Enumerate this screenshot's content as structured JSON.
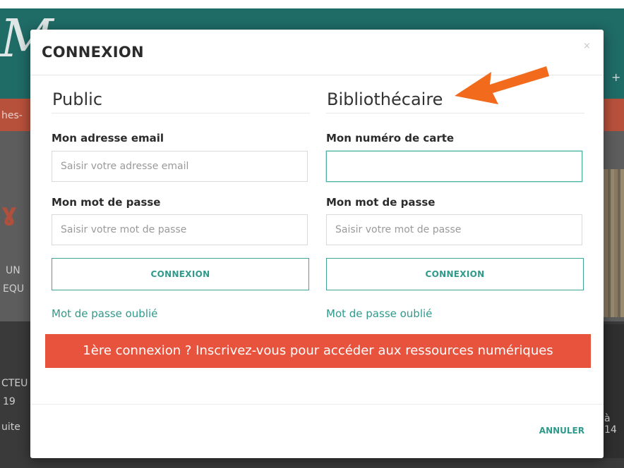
{
  "background": {
    "nav_fragment": "hes-",
    "plus_glyph": "+",
    "fragments": [
      "UN",
      "EQU",
      "CTEU",
      "19",
      "uite",
      "à 14"
    ]
  },
  "modal": {
    "title": "CONNEXION",
    "close_glyph": "×",
    "public": {
      "heading": "Public",
      "email_label": "Mon adresse email",
      "email_placeholder": "Saisir votre adresse email",
      "password_label": "Mon mot de passe",
      "password_placeholder": "Saisir votre mot de passe",
      "login_label": "CONNEXION",
      "forgot_label": "Mot de passe oublié"
    },
    "librarian": {
      "heading": "Bibliothécaire",
      "card_label": "Mon numéro de carte",
      "card_value": "",
      "password_label": "Mon mot de passe",
      "password_placeholder": "Saisir votre mot de passe",
      "login_label": "CONNEXION",
      "forgot_label": "Mot de passe oublié"
    },
    "signup_banner": "1ère connexion ? Inscrivez-vous pour accéder aux ressources numériques",
    "cancel_label": "ANNULER"
  },
  "colors": {
    "accent": "#2f9a8b",
    "banner": "#e8533d",
    "annotation_arrow": "#f26b1d"
  }
}
